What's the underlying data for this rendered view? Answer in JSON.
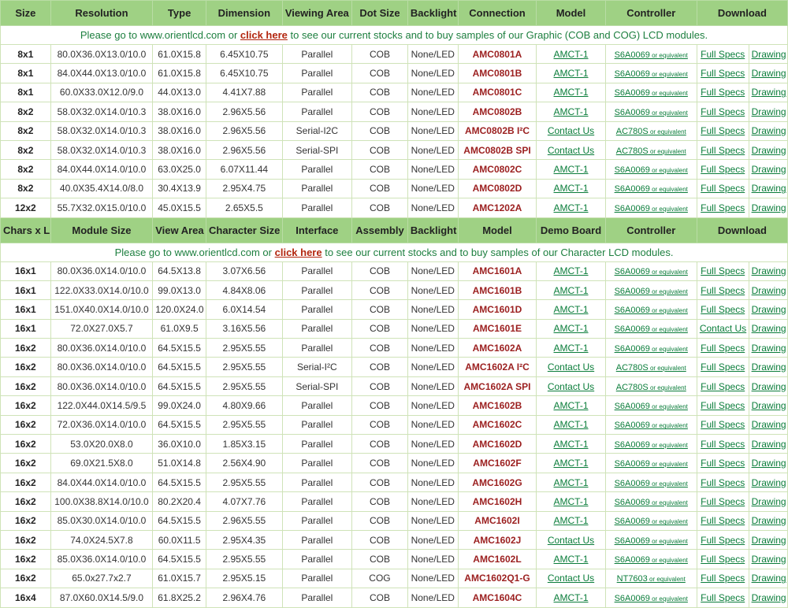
{
  "header1": [
    "Size",
    "Resolution",
    "Type",
    "Dimension",
    "Viewing Area",
    "Dot Size",
    "Backlight",
    "Connection",
    "Model",
    "Controller",
    "Download"
  ],
  "note1": {
    "before": "Please go to www.orientlcd.com or ",
    "link": "click here",
    "after": " to see our current stocks and to buy samples of our Graphic (COB and COG) LCD modules."
  },
  "graphic_rows": [
    {
      "size": "8x1",
      "res": "80.0X36.0X13.0/10.0",
      "type": "61.0X15.8",
      "dim": "6.45X10.75",
      "view": "Parallel",
      "dot": "COB",
      "back": "None/LED",
      "conn": "AMC0801A",
      "model": "AMCT-1",
      "ctrl": "S6A0069",
      "ctrl_suffix": " or equivalent",
      "d1": "Full Specs",
      "d2": "Drawing"
    },
    {
      "size": "8x1",
      "res": "84.0X44.0X13.0/10.0",
      "type": "61.0X15.8",
      "dim": "6.45X10.75",
      "view": "Parallel",
      "dot": "COB",
      "back": "None/LED",
      "conn": "AMC0801B",
      "model": "AMCT-1",
      "ctrl": "S6A0069",
      "ctrl_suffix": " or equivalent",
      "d1": "Full Specs",
      "d2": "Drawing"
    },
    {
      "size": "8x1",
      "res": "60.0X33.0X12.0/9.0",
      "type": "44.0X13.0",
      "dim": "4.41X7.88",
      "view": "Parallel",
      "dot": "COB",
      "back": "None/LED",
      "conn": "AMC0801C",
      "model": "AMCT-1",
      "ctrl": "S6A0069",
      "ctrl_suffix": " or equivalent",
      "d1": "Full Specs",
      "d2": "Drawing"
    },
    {
      "size": "8x2",
      "res": "58.0X32.0X14.0/10.3",
      "type": "38.0X16.0",
      "dim": "2.96X5.56",
      "view": "Parallel",
      "dot": "COB",
      "back": "None/LED",
      "conn": "AMC0802B",
      "model": "AMCT-1",
      "ctrl": "S6A0069",
      "ctrl_suffix": " or equivalent",
      "d1": "Full Specs",
      "d2": "Drawing"
    },
    {
      "size": "8x2",
      "res": "58.0X32.0X14.0/10.3",
      "type": "38.0X16.0",
      "dim": "2.96X5.56",
      "view": "Serial-I2C",
      "dot": "COB",
      "back": "None/LED",
      "conn": "AMC0802B I²C",
      "model": "Contact Us",
      "ctrl": "AC780S",
      "ctrl_suffix": " or equivalent",
      "d1": "Full Specs",
      "d2": "Drawing"
    },
    {
      "size": "8x2",
      "res": "58.0X32.0X14.0/10.3",
      "type": "38.0X16.0",
      "dim": "2.96X5.56",
      "view": "Serial-SPI",
      "dot": "COB",
      "back": "None/LED",
      "conn": "AMC0802B SPI",
      "model": "Contact Us",
      "ctrl": "AC780S",
      "ctrl_suffix": " or equivalent",
      "d1": "Full Specs",
      "d2": "Drawing"
    },
    {
      "size": "8x2",
      "res": "84.0X44.0X14.0/10.0",
      "type": "63.0X25.0",
      "dim": "6.07X11.44",
      "view": "Parallel",
      "dot": "COB",
      "back": "None/LED",
      "conn": "AMC0802C",
      "model": "AMCT-1",
      "ctrl": "S6A0069",
      "ctrl_suffix": " or equivalent",
      "d1": "Full Specs",
      "d2": "Drawing"
    },
    {
      "size": "8x2",
      "res": "40.0X35.4X14.0/8.0",
      "type": "30.4X13.9",
      "dim": "2.95X4.75",
      "view": "Parallel",
      "dot": "COB",
      "back": "None/LED",
      "conn": "AMC0802D",
      "model": "AMCT-1",
      "ctrl": "S6A0069",
      "ctrl_suffix": " or equivalent",
      "d1": "Full Specs",
      "d2": "Drawing"
    },
    {
      "size": "12x2",
      "res": "55.7X32.0X15.0/10.0",
      "type": "45.0X15.5",
      "dim": "2.65X5.5",
      "view": "Parallel",
      "dot": "COB",
      "back": "None/LED",
      "conn": "AMC1202A",
      "model": "AMCT-1",
      "ctrl": "S6A0069",
      "ctrl_suffix": " or equivalent",
      "d1": "Full Specs",
      "d2": "Drawing"
    }
  ],
  "header2": [
    "Chars x Lines",
    "Module Size",
    "View Area",
    "Character Size",
    "Interface",
    "Assembly",
    "Backlight",
    "Model",
    "Demo Board",
    "Controller",
    "Download"
  ],
  "note2": {
    "before": "Please go to www.orientlcd.com or ",
    "link": "click here",
    "after": " to see our current stocks and to buy samples of our Character LCD modules."
  },
  "char_rows": [
    {
      "size": "16x1",
      "res": "80.0X36.0X14.0/10.0",
      "type": "64.5X13.8",
      "dim": "3.07X6.56",
      "view": "Parallel",
      "dot": "COB",
      "back": "None/LED",
      "conn": "AMC1601A",
      "model": "AMCT-1",
      "ctrl": "S6A0069",
      "ctrl_suffix": " or equivalent",
      "d1": "Full Specs",
      "d2": "Drawing"
    },
    {
      "size": "16x1",
      "res": "122.0X33.0X14.0/10.0",
      "type": "99.0X13.0",
      "dim": "4.84X8.06",
      "view": "Parallel",
      "dot": "COB",
      "back": "None/LED",
      "conn": "AMC1601B",
      "model": "AMCT-1",
      "ctrl": "S6A0069",
      "ctrl_suffix": " or equivalent",
      "d1": "Full Specs",
      "d2": "Drawing"
    },
    {
      "size": "16x1",
      "res": "151.0X40.0X14.0/10.0",
      "type": "120.0X24.0",
      "dim": "6.0X14.54",
      "view": "Parallel",
      "dot": "COB",
      "back": "None/LED",
      "conn": "AMC1601D",
      "model": "AMCT-1",
      "ctrl": "S6A0069",
      "ctrl_suffix": " or equivalent",
      "d1": "Full Specs",
      "d2": "Drawing"
    },
    {
      "size": "16x1",
      "res": "72.0X27.0X5.7",
      "type": "61.0X9.5",
      "dim": "3.16X5.56",
      "view": "Parallel",
      "dot": "COB",
      "back": "None/LED",
      "conn": "AMC1601E",
      "model": "AMCT-1",
      "ctrl": "S6A0069",
      "ctrl_suffix": " or equivalent",
      "d1": "Contact Us",
      "d2": "Drawing"
    },
    {
      "size": "16x2",
      "res": "80.0X36.0X14.0/10.0",
      "type": "64.5X15.5",
      "dim": "2.95X5.55",
      "view": "Parallel",
      "dot": "COB",
      "back": "None/LED",
      "conn": "AMC1602A",
      "model": "AMCT-1",
      "ctrl": "S6A0069",
      "ctrl_suffix": " or equivalent",
      "d1": "Full Specs",
      "d2": "Drawing"
    },
    {
      "size": "16x2",
      "res": "80.0X36.0X14.0/10.0",
      "type": "64.5X15.5",
      "dim": "2.95X5.55",
      "view": "Serial-I²C",
      "dot": "COB",
      "back": "None/LED",
      "conn": "AMC1602A I²C",
      "model": "Contact Us",
      "ctrl": "AC780S",
      "ctrl_suffix": " or equivalent",
      "d1": "Full Specs",
      "d2": "Drawing"
    },
    {
      "size": "16x2",
      "res": "80.0X36.0X14.0/10.0",
      "type": "64.5X15.5",
      "dim": "2.95X5.55",
      "view": "Serial-SPI",
      "dot": "COB",
      "back": "None/LED",
      "conn": "AMC1602A SPI",
      "model": "Contact Us",
      "ctrl": "AC780S",
      "ctrl_suffix": " or equivalent",
      "d1": "Full Specs",
      "d2": "Drawing"
    },
    {
      "size": "16x2",
      "res": "122.0X44.0X14.5/9.5",
      "type": "99.0X24.0",
      "dim": "4.80X9.66",
      "view": "Parallel",
      "dot": "COB",
      "back": "None/LED",
      "conn": "AMC1602B",
      "model": "AMCT-1",
      "ctrl": "S6A0069",
      "ctrl_suffix": " or equivalent",
      "d1": "Full Specs",
      "d2": "Drawing"
    },
    {
      "size": "16x2",
      "res": "72.0X36.0X14.0/10.0",
      "type": "64.5X15.5",
      "dim": "2.95X5.55",
      "view": "Parallel",
      "dot": "COB",
      "back": "None/LED",
      "conn": "AMC1602C",
      "model": "AMCT-1",
      "ctrl": "S6A0069",
      "ctrl_suffix": " or equivalent",
      "d1": "Full Specs",
      "d2": "Drawing"
    },
    {
      "size": "16x2",
      "res": "53.0X20.0X8.0",
      "type": "36.0X10.0",
      "dim": "1.85X3.15",
      "view": "Parallel",
      "dot": "COB",
      "back": "None/LED",
      "conn": "AMC1602D",
      "model": "AMCT-1",
      "ctrl": "S6A0069",
      "ctrl_suffix": " or equivalent",
      "d1": "Full Specs",
      "d2": "Drawing"
    },
    {
      "size": "16x2",
      "res": "69.0X21.5X8.0",
      "type": "51.0X14.8",
      "dim": "2.56X4.90",
      "view": "Parallel",
      "dot": "COB",
      "back": "None/LED",
      "conn": "AMC1602F",
      "model": "AMCT-1",
      "ctrl": "S6A0069",
      "ctrl_suffix": " or equivalent",
      "d1": "Full Specs",
      "d2": "Drawing"
    },
    {
      "size": "16x2",
      "res": "84.0X44.0X14.0/10.0",
      "type": "64.5X15.5",
      "dim": "2.95X5.55",
      "view": "Parallel",
      "dot": "COB",
      "back": "None/LED",
      "conn": "AMC1602G",
      "model": "AMCT-1",
      "ctrl": "S6A0069",
      "ctrl_suffix": " or equivalent",
      "d1": "Full Specs",
      "d2": "Drawing"
    },
    {
      "size": "16x2",
      "res": "100.0X38.8X14.0/10.0",
      "type": "80.2X20.4",
      "dim": "4.07X7.76",
      "view": "Parallel",
      "dot": "COB",
      "back": "None/LED",
      "conn": "AMC1602H",
      "model": "AMCT-1",
      "ctrl": "S6A0069",
      "ctrl_suffix": " or equivalent",
      "d1": "Full Specs",
      "d2": "Drawing"
    },
    {
      "size": "16x2",
      "res": "85.0X30.0X14.0/10.0",
      "type": "64.5X15.5",
      "dim": "2.96X5.55",
      "view": "Parallel",
      "dot": "COB",
      "back": "None/LED",
      "conn": "AMC1602I",
      "model": "AMCT-1",
      "ctrl": "S6A0069",
      "ctrl_suffix": " or equivalent",
      "d1": "Full Specs",
      "d2": "Drawing"
    },
    {
      "size": "16x2",
      "res": "74.0X24.5X7.8",
      "type": "60.0X11.5",
      "dim": "2.95X4.35",
      "view": "Parallel",
      "dot": "COB",
      "back": "None/LED",
      "conn": "AMC1602J",
      "model": "Contact Us",
      "ctrl": "S6A0069",
      "ctrl_suffix": " or equivalent",
      "d1": "Full Specs",
      "d2": "Drawing"
    },
    {
      "size": "16x2",
      "res": "85.0X36.0X14.0/10.0",
      "type": "64.5X15.5",
      "dim": "2.95X5.55",
      "view": "Parallel",
      "dot": "COB",
      "back": "None/LED",
      "conn": "AMC1602L",
      "model": "AMCT-1",
      "ctrl": "S6A0069",
      "ctrl_suffix": " or equivalent",
      "d1": "Full Specs",
      "d2": "Drawing"
    },
    {
      "size": "16x2",
      "res": "65.0x27.7x2.7",
      "type": "61.0X15.7",
      "dim": "2.95X5.15",
      "view": "Parallel",
      "dot": "COG",
      "back": "None/LED",
      "conn": "AMC1602Q1-G",
      "model": "Contact Us",
      "ctrl": "NT7603",
      "ctrl_suffix": " or equivalent",
      "d1": "Full Specs",
      "d2": "Drawing"
    },
    {
      "size": "16x4",
      "res": "87.0X60.0X14.5/9.0",
      "type": "61.8X25.2",
      "dim": "2.96X4.76",
      "view": "Parallel",
      "dot": "COB",
      "back": "None/LED",
      "conn": "AMC1604C",
      "model": "AMCT-1",
      "ctrl": "S6A0069",
      "ctrl_suffix": " or equivalent",
      "d1": "Full Specs",
      "d2": "Drawing"
    }
  ]
}
